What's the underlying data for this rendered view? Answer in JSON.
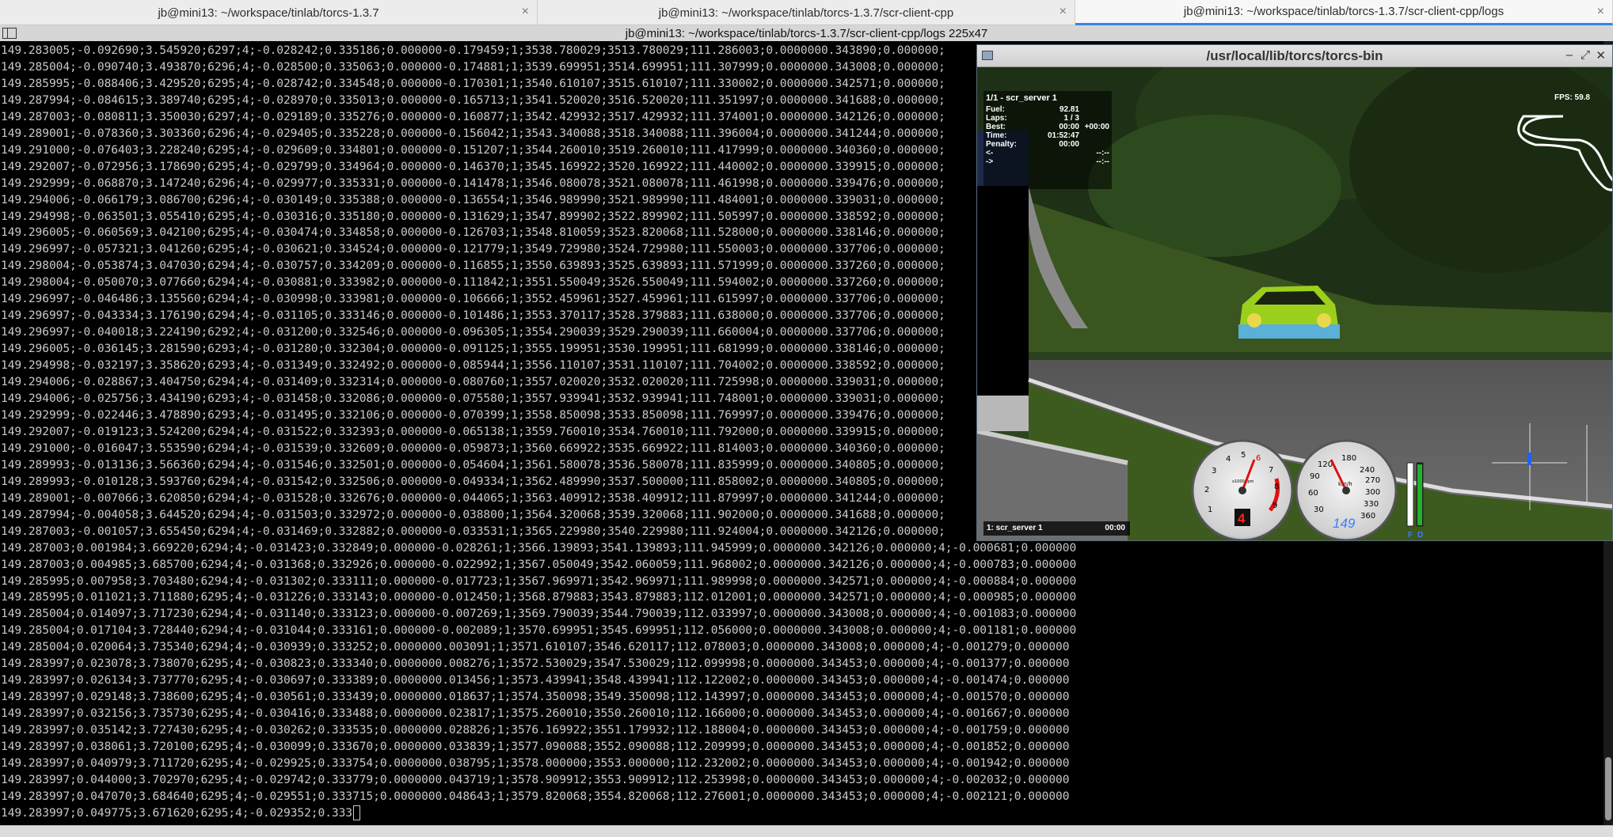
{
  "tabs": [
    {
      "label": "jb@mini13: ~/workspace/tinlab/torcs-1.3.7",
      "close": "×"
    },
    {
      "label": "jb@mini13: ~/workspace/tinlab/torcs-1.3.7/scr-client-cpp",
      "close": "×"
    },
    {
      "label": "jb@mini13: ~/workspace/tinlab/torcs-1.3.7/scr-client-cpp/logs",
      "close": "×"
    }
  ],
  "terminal_title": "jb@mini13: ~/workspace/tinlab/torcs-1.3.7/scr-client-cpp/logs 225x47",
  "log_lines": [
    "149.283005;-0.092690;3.545920;6297;4;-0.028242;0.335186;0.000000-0.179459;1;3538.780029;3513.780029;111.286003;0.0000000.343890;0.000000;",
    "149.285004;-0.090740;3.493870;6296;4;-0.028500;0.335063;0.000000-0.174881;1;3539.699951;3514.699951;111.307999;0.0000000.343008;0.000000;",
    "149.285995;-0.088406;3.429520;6295;4;-0.028742;0.334548;0.000000-0.170301;1;3540.610107;3515.610107;111.330002;0.0000000.342571;0.000000;",
    "149.287994;-0.084615;3.389740;6295;4;-0.028970;0.335013;0.000000-0.165713;1;3541.520020;3516.520020;111.351997;0.0000000.341688;0.000000;",
    "149.287003;-0.080811;3.350030;6297;4;-0.029189;0.335276;0.000000-0.160877;1;3542.429932;3517.429932;111.374001;0.0000000.342126;0.000000;",
    "149.289001;-0.078360;3.303360;6296;4;-0.029405;0.335228;0.000000-0.156042;1;3543.340088;3518.340088;111.396004;0.0000000.341244;0.000000;",
    "149.291000;-0.076403;3.228240;6295;4;-0.029609;0.334801;0.000000-0.151207;1;3544.260010;3519.260010;111.417999;0.0000000.340360;0.000000;",
    "149.292007;-0.072956;3.178690;6295;4;-0.029799;0.334964;0.000000-0.146370;1;3545.169922;3520.169922;111.440002;0.0000000.339915;0.000000;",
    "149.292999;-0.068870;3.147240;6296;4;-0.029977;0.335331;0.000000-0.141478;1;3546.080078;3521.080078;111.461998;0.0000000.339476;0.000000;",
    "149.294006;-0.066179;3.086700;6296;4;-0.030149;0.335388;0.000000-0.136554;1;3546.989990;3521.989990;111.484001;0.0000000.339031;0.000000;",
    "149.294998;-0.063501;3.055410;6295;4;-0.030316;0.335180;0.000000-0.131629;1;3547.899902;3522.899902;111.505997;0.0000000.338592;0.000000;",
    "149.296005;-0.060569;3.042100;6295;4;-0.030474;0.334858;0.000000-0.126703;1;3548.810059;3523.820068;111.528000;0.0000000.338146;0.000000;",
    "149.296997;-0.057321;3.041260;6295;4;-0.030621;0.334524;0.000000-0.121779;1;3549.729980;3524.729980;111.550003;0.0000000.337706;0.000000;",
    "149.298004;-0.053874;3.047030;6294;4;-0.030757;0.334209;0.000000-0.116855;1;3550.639893;3525.639893;111.571999;0.0000000.337260;0.000000;",
    "149.298004;-0.050070;3.077660;6294;4;-0.030881;0.333982;0.000000-0.111842;1;3551.550049;3526.550049;111.594002;0.0000000.337260;0.000000;",
    "149.296997;-0.046486;3.135560;6294;4;-0.030998;0.333981;0.000000-0.106666;1;3552.459961;3527.459961;111.615997;0.0000000.337706;0.000000;",
    "149.296997;-0.043334;3.176190;6294;4;-0.031105;0.333146;0.000000-0.101486;1;3553.370117;3528.379883;111.638000;0.0000000.337706;0.000000;",
    "149.296997;-0.040018;3.224190;6292;4;-0.031200;0.332546;0.000000-0.096305;1;3554.290039;3529.290039;111.660004;0.0000000.337706;0.000000;",
    "149.296005;-0.036145;3.281590;6293;4;-0.031280;0.332304;0.000000-0.091125;1;3555.199951;3530.199951;111.681999;0.0000000.338146;0.000000;",
    "149.294998;-0.032197;3.358620;6293;4;-0.031349;0.332492;0.000000-0.085944;1;3556.110107;3531.110107;111.704002;0.0000000.338592;0.000000;",
    "149.294006;-0.028867;3.404750;6294;4;-0.031409;0.332314;0.000000-0.080760;1;3557.020020;3532.020020;111.725998;0.0000000.339031;0.000000;",
    "149.294006;-0.025756;3.434190;6293;4;-0.031458;0.332086;0.000000-0.075580;1;3557.939941;3532.939941;111.748001;0.0000000.339031;0.000000;",
    "149.292999;-0.022446;3.478890;6293;4;-0.031495;0.332106;0.000000-0.070399;1;3558.850098;3533.850098;111.769997;0.0000000.339476;0.000000;",
    "149.292007;-0.019123;3.524200;6294;4;-0.031522;0.332393;0.000000-0.065138;1;3559.760010;3534.760010;111.792000;0.0000000.339915;0.000000;",
    "149.291000;-0.016047;3.553590;6294;4;-0.031539;0.332609;0.000000-0.059873;1;3560.669922;3535.669922;111.814003;0.0000000.340360;0.000000;",
    "149.289993;-0.013136;3.566360;6294;4;-0.031546;0.332501;0.000000-0.054604;1;3561.580078;3536.580078;111.835999;0.0000000.340805;0.000000;",
    "149.289993;-0.010128;3.593760;6294;4;-0.031542;0.332506;0.000000-0.049334;1;3562.489990;3537.500000;111.858002;0.0000000.340805;0.000000;",
    "149.289001;-0.007066;3.620850;6294;4;-0.031528;0.332676;0.000000-0.044065;1;3563.409912;3538.409912;111.879997;0.0000000.341244;0.000000;",
    "149.287994;-0.004058;3.644520;6294;4;-0.031503;0.332972;0.000000-0.038800;1;3564.320068;3539.320068;111.902000;0.0000000.341688;0.000000;",
    "149.287003;-0.001057;3.655450;6294;4;-0.031469;0.332882;0.000000-0.033531;1;3565.229980;3540.229980;111.924004;0.0000000.342126;0.000000;",
    "149.287003;0.001984;3.669220;6294;4;-0.031423;0.332849;0.000000-0.028261;1;3566.139893;3541.139893;111.945999;0.0000000.342126;0.000000;4;-0.000681;0.000000",
    "149.287003;0.004985;3.685700;6294;4;-0.031368;0.332926;0.000000-0.022992;1;3567.050049;3542.060059;111.968002;0.0000000.342126;0.000000;4;-0.000783;0.000000",
    "149.285995;0.007958;3.703480;6294;4;-0.031302;0.333111;0.000000-0.017723;1;3567.969971;3542.969971;111.989998;0.0000000.342571;0.000000;4;-0.000884;0.000000",
    "149.285995;0.011021;3.711880;6295;4;-0.031226;0.333143;0.000000-0.012450;1;3568.879883;3543.879883;112.012001;0.0000000.342571;0.000000;4;-0.000985;0.000000",
    "149.285004;0.014097;3.717230;6294;4;-0.031140;0.333123;0.000000-0.007269;1;3569.790039;3544.790039;112.033997;0.0000000.343008;0.000000;4;-0.001083;0.000000",
    "149.285004;0.017104;3.728440;6294;4;-0.031044;0.333161;0.000000-0.002089;1;3570.699951;3545.699951;112.056000;0.0000000.343008;0.000000;4;-0.001181;0.000000",
    "149.285004;0.020064;3.735340;6294;4;-0.030939;0.333252;0.0000000.003091;1;3571.610107;3546.620117;112.078003;0.0000000.343008;0.000000;4;-0.001279;0.000000",
    "149.283997;0.023078;3.738070;6295;4;-0.030823;0.333340;0.0000000.008276;1;3572.530029;3547.530029;112.099998;0.0000000.343453;0.000000;4;-0.001377;0.000000",
    "149.283997;0.026134;3.737770;6295;4;-0.030697;0.333389;0.0000000.013456;1;3573.439941;3548.439941;112.122002;0.0000000.343453;0.000000;4;-0.001474;0.000000",
    "149.283997;0.029148;3.738600;6295;4;-0.030561;0.333439;0.0000000.018637;1;3574.350098;3549.350098;112.143997;0.0000000.343453;0.000000;4;-0.001570;0.000000",
    "149.283997;0.032156;3.735730;6295;4;-0.030416;0.333488;0.0000000.023817;1;3575.260010;3550.260010;112.166000;0.0000000.343453;0.000000;4;-0.001667;0.000000",
    "149.283997;0.035142;3.727430;6295;4;-0.030262;0.333535;0.0000000.028826;1;3576.169922;3551.179932;112.188004;0.0000000.343453;0.000000;4;-0.001759;0.000000",
    "149.283997;0.038061;3.720100;6295;4;-0.030099;0.333670;0.0000000.033839;1;3577.090088;3552.090088;112.209999;0.0000000.343453;0.000000;4;-0.001852;0.000000",
    "149.283997;0.040979;3.711720;6295;4;-0.029925;0.333754;0.0000000.038795;1;3578.000000;3553.000000;112.232002;0.0000000.343453;0.000000;4;-0.001942;0.000000",
    "149.283997;0.044000;3.702970;6295;4;-0.029742;0.333779;0.0000000.043719;1;3578.909912;3553.909912;112.253998;0.0000000.343453;0.000000;4;-0.002032;0.000000",
    "149.283997;0.047070;3.684640;6295;4;-0.029551;0.333715;0.0000000.048643;1;3579.820068;3554.820068;112.276001;0.0000000.343453;0.000000;4;-0.002121;0.000000",
    "149.283997;0.049775;3.671620;6295;4;-0.029352;0.333"
  ],
  "torcs": {
    "title": "/usr/local/lib/torcs/torcs-bin",
    "window_buttons": {
      "minimize": "–",
      "maximize": "⤢",
      "close": "✕"
    },
    "hud": {
      "race_title": "1/1 - scr_server 1",
      "rows": [
        {
          "label": "Fuel:",
          "value": "92.81",
          "extra": ""
        },
        {
          "label": "Laps:",
          "value": "1 / 3",
          "extra": ""
        },
        {
          "label": "Best:",
          "value": "00:00",
          "extra": "+00:00"
        },
        {
          "label": "Time:",
          "value": "01:52:47",
          "extra": ""
        },
        {
          "label": "Penalty:",
          "value": "00:00",
          "extra": ""
        },
        {
          "label": "<-",
          "value": "",
          "extra": "--:--"
        },
        {
          "label": "->",
          "value": "",
          "extra": "--:--"
        }
      ]
    },
    "fps": "FPS: 59.8",
    "bottom_driver": "1: scr_server 1",
    "bottom_time": "00:00",
    "tach": {
      "unit": "x1000 rpm",
      "ticks": [
        "1",
        "2",
        "3",
        "4",
        "5",
        "6",
        "7",
        "8",
        "9"
      ],
      "gear": "4"
    },
    "speedo": {
      "unit": "km/h",
      "ticks": [
        "30",
        "60",
        "90",
        "120",
        "180",
        "240",
        "270",
        "300",
        "330",
        "360"
      ],
      "speed": "149"
    },
    "bars": {
      "left_label": "F",
      "right_label": "D"
    },
    "colors": {
      "sky": "#1d2a18",
      "grass": "#3f5a22",
      "road": "#5d5d5d",
      "car_body": "#9ccf1b",
      "speed_text": "#3a7cff",
      "gear_text": "#ff2020"
    }
  }
}
